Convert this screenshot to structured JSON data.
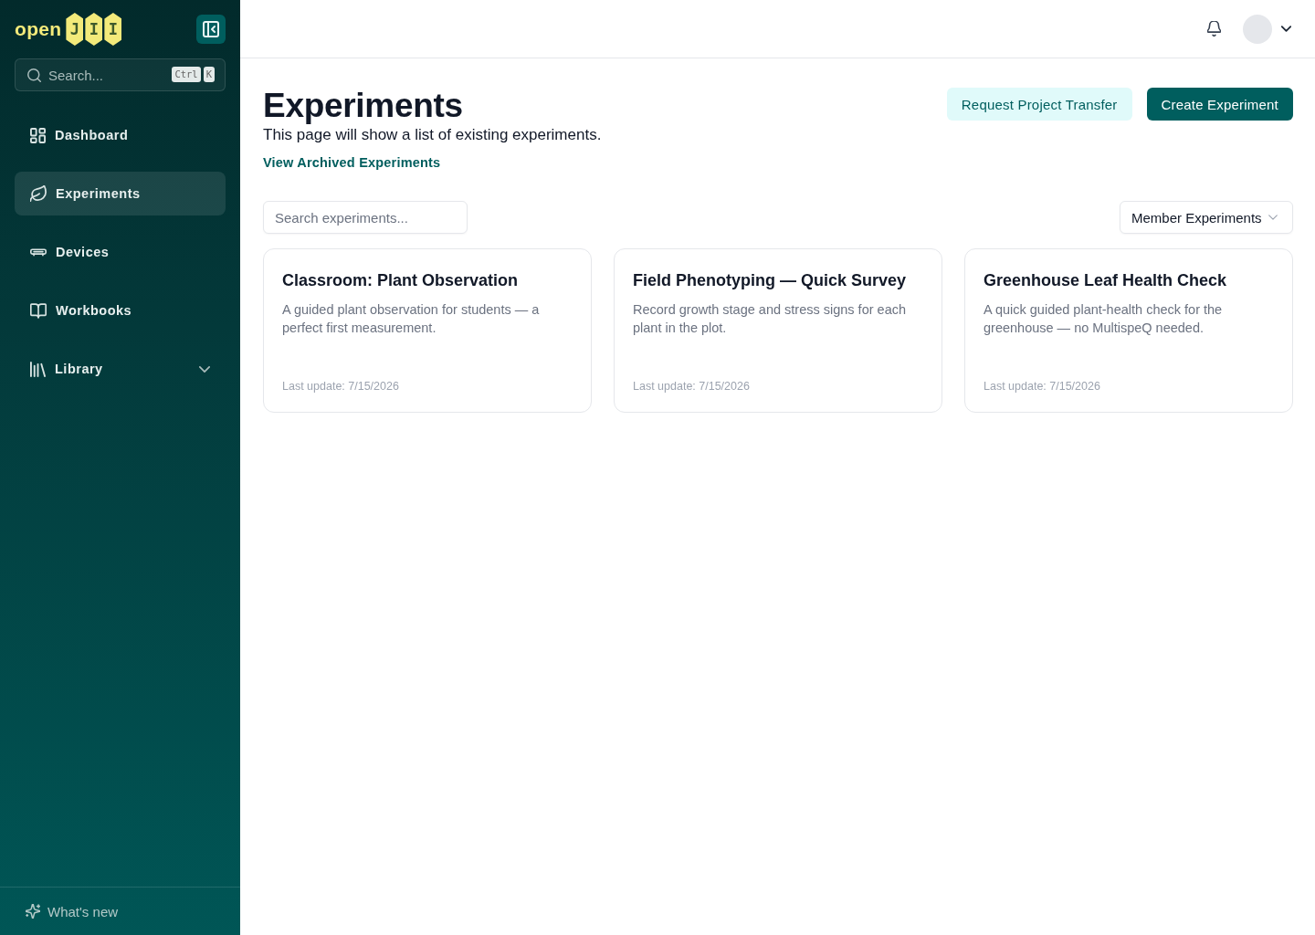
{
  "sidebar": {
    "logo": {
      "word": "open",
      "tiles": [
        "J",
        "I",
        "I"
      ]
    },
    "search": {
      "placeholder": "Search...",
      "shortcut": [
        "Ctrl",
        "K"
      ]
    },
    "items": [
      {
        "label": "Dashboard",
        "kind": "link",
        "selected": false
      },
      {
        "label": "Experiments",
        "kind": "link",
        "selected": true
      },
      {
        "label": "Devices",
        "kind": "link",
        "selected": false
      },
      {
        "label": "Workbooks",
        "kind": "link",
        "selected": false
      },
      {
        "label": "Library",
        "kind": "group",
        "selected": false,
        "expanded": false
      }
    ],
    "footer": {
      "label": "What's new"
    }
  },
  "main": {
    "title": "Experiments",
    "subtitle": "This page will show a list of existing experiments.",
    "archive_link": "View Archived Experiments",
    "actions": [
      {
        "label": "Request Project Transfer",
        "kind": "secondary"
      },
      {
        "label": "Create Experiment",
        "kind": "primary"
      }
    ],
    "search": {
      "placeholder": "Search experiments..."
    },
    "filter": {
      "value": "Member Experiments"
    },
    "cards": [
      {
        "title": "Classroom: Plant Observation",
        "description": "A guided plant observation for students — a perfect first measurement.",
        "updated": "Last update: 7/15/2026"
      },
      {
        "title": "Field Phenotyping — Quick Survey",
        "description": "Record growth stage and stress signs for each plant in the plot.",
        "updated": "Last update: 7/15/2026"
      },
      {
        "title": "Greenhouse Leaf Health Check",
        "description": "A quick guided plant-health check for the greenhouse — no MultispeQ needed.",
        "updated": "Last update: 7/15/2026"
      }
    ]
  }
}
